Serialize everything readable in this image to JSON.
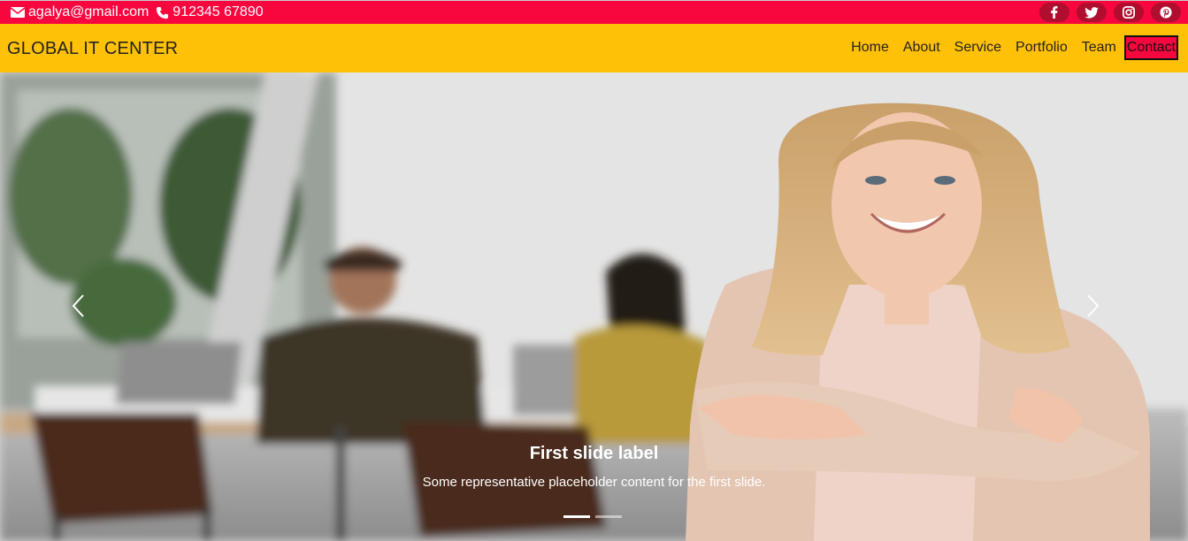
{
  "topbar": {
    "email": "agalya@gmail.com",
    "phone": "912345 67890",
    "socials": [
      {
        "icon": "facebook-icon",
        "glyph": "f"
      },
      {
        "icon": "twitter-icon",
        "glyph": "t"
      },
      {
        "icon": "instagram-icon",
        "glyph": "◎"
      },
      {
        "icon": "pinterest-icon",
        "glyph": "p"
      }
    ]
  },
  "navbar": {
    "brand": "GLOBAL IT CENTER",
    "links": [
      "Home",
      "About",
      "Service",
      "Portfolio",
      "Team",
      "Contact"
    ],
    "active": "Contact"
  },
  "carousel": {
    "caption_title": "First slide label",
    "caption_text": "Some representative placeholder content for the first slide.",
    "active_index": 0,
    "slide_count": 2
  },
  "colors": {
    "topbar": "#f8073f",
    "navbar": "#ffc107"
  }
}
